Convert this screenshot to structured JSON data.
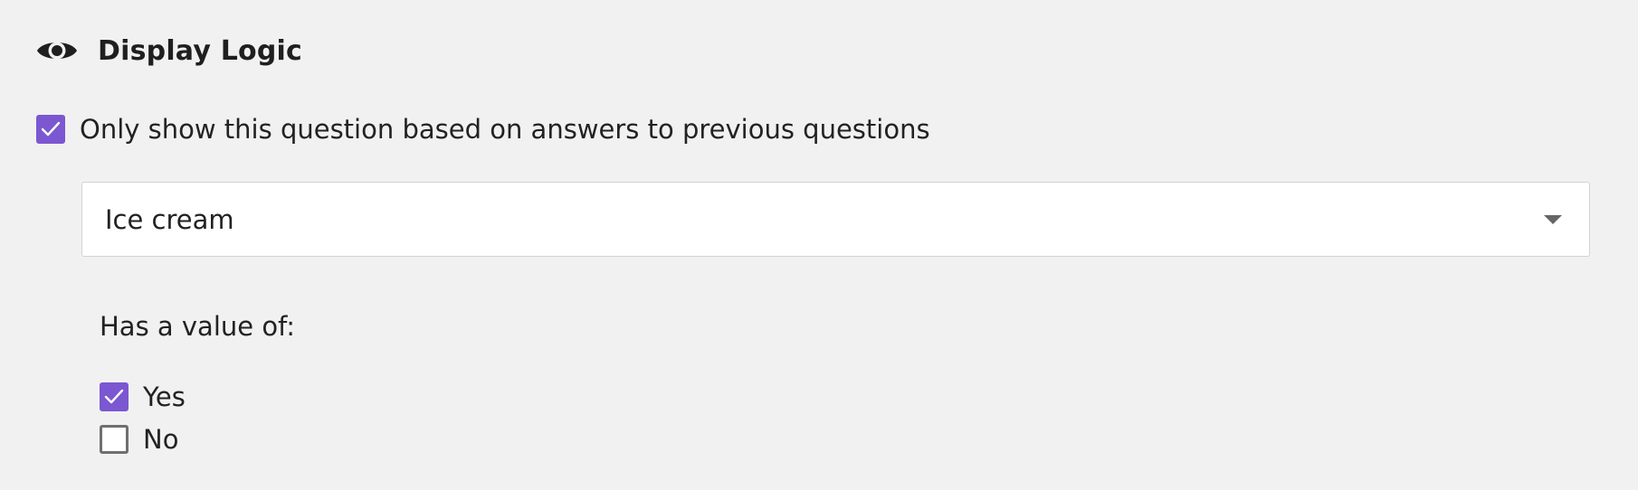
{
  "display_logic": {
    "title": "Display Logic",
    "header_icon": "eye-icon",
    "accent_color": "#7b57d1",
    "toggle": {
      "label": "Only show this question based on answers to previous questions",
      "checked": true
    },
    "question_select": {
      "selected_value": "Ice cream",
      "icon": "caret-down-icon"
    },
    "value_condition": {
      "label": "Has a value of:",
      "options": [
        {
          "label": "Yes",
          "checked": true
        },
        {
          "label": "No",
          "checked": false
        }
      ]
    }
  }
}
